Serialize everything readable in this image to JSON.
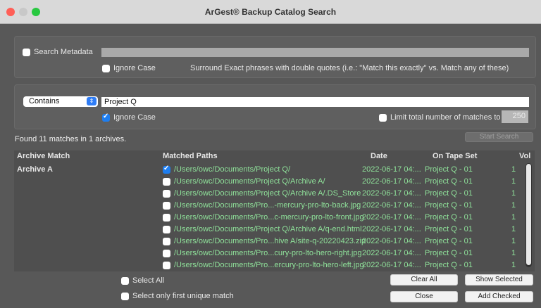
{
  "window": {
    "title": "ArGest® Backup Catalog Search"
  },
  "metadata": {
    "search_metadata_label": "Search Metadata",
    "ignore_case_label": "Ignore Case",
    "hint": "Surround Exact phrases with double quotes (i.e.: \"Match this exactly\" vs. Match any of these)"
  },
  "search": {
    "mode": "Contains",
    "query": "Project Q",
    "ignore_case_label": "Ignore Case",
    "limit_label": "Limit total number of matches to",
    "limit_value": "250",
    "status": "Found 11 matches in 1 archives.",
    "start_button": "Start Search"
  },
  "table": {
    "headers": {
      "archive": "Archive Match",
      "paths": "Matched Paths",
      "date": "Date",
      "tape": "On Tape Set",
      "vol": "Vol"
    },
    "archive_name": "Archive A",
    "rows": [
      {
        "path": "/Users/owc/Documents/Project Q/",
        "date": "2022-06-17 04:...",
        "tape": "Project Q - 01",
        "vol": "1",
        "checked": true
      },
      {
        "path": "/Users/owc/Documents/Project Q/Archive A/",
        "date": "2022-06-17 04:...",
        "tape": "Project Q - 01",
        "vol": "1",
        "checked": false
      },
      {
        "path": "/Users/owc/Documents/Project Q/Archive A/.DS_Store",
        "date": "2022-06-17 04:...",
        "tape": "Project Q - 01",
        "vol": "1",
        "checked": false
      },
      {
        "path": "/Users/owc/Documents/Pro...-mercury-pro-lto-back.jpg",
        "date": "2022-06-17 04:...",
        "tape": "Project Q - 01",
        "vol": "1",
        "checked": false
      },
      {
        "path": "/Users/owc/Documents/Pro...c-mercury-pro-lto-front.jpg",
        "date": "2022-06-17 04:...",
        "tape": "Project Q - 01",
        "vol": "1",
        "checked": false
      },
      {
        "path": "/Users/owc/Documents/Project Q/Archive A/q-end.html",
        "date": "2022-06-17 04:...",
        "tape": "Project Q - 01",
        "vol": "1",
        "checked": false
      },
      {
        "path": "/Users/owc/Documents/Pro...hive A/site-q-20220423.zip",
        "date": "2022-06-17 04:...",
        "tape": "Project Q - 01",
        "vol": "1",
        "checked": false
      },
      {
        "path": "/Users/owc/Documents/Pro...cury-pro-lto-hero-right.jpg",
        "date": "2022-06-17 04:...",
        "tape": "Project Q - 01",
        "vol": "1",
        "checked": false
      },
      {
        "path": "/Users/owc/Documents/Pro...ercury-pro-lto-hero-left.jpg",
        "date": "2022-06-17 04:...",
        "tape": "Project Q - 01",
        "vol": "1",
        "checked": false
      }
    ]
  },
  "footer": {
    "select_all": "Select All",
    "select_first_unique": "Select only first unique match",
    "clear_all": "Clear All",
    "show_selected": "Show Selected",
    "close": "Close",
    "add_checked": "Add Checked"
  }
}
